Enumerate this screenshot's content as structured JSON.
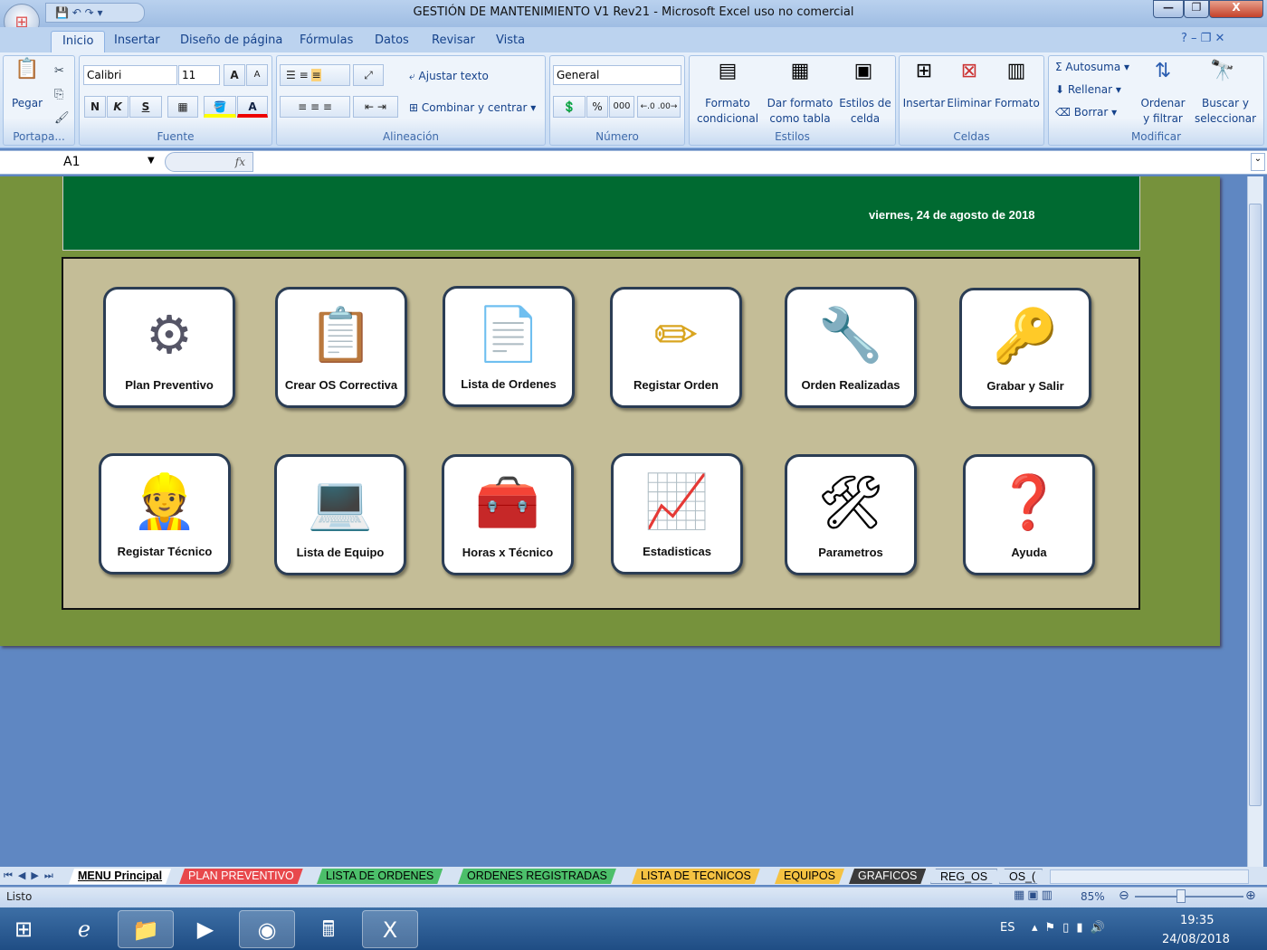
{
  "window": {
    "title": "GESTIÓN DE MANTENIMIENTO V1 Rev21  -  Microsoft Excel uso no comercial",
    "minimize": "—",
    "restore": "❐",
    "close": "X"
  },
  "ribbon_tabs": [
    "Inicio",
    "Insertar",
    "Diseño de página",
    "Fórmulas",
    "Datos",
    "Revisar",
    "Vista"
  ],
  "clipboard": {
    "paste": "Pegar",
    "label": "Portapa..."
  },
  "font": {
    "name": "Calibri",
    "size": "11",
    "grow": "A",
    "shrink": "A",
    "bold": "N",
    "italic": "K",
    "underline": "S",
    "label": "Fuente"
  },
  "alignment": {
    "wrap": "Ajustar texto",
    "merge": "Combinar y centrar",
    "label": "Alineación"
  },
  "number": {
    "format": "General",
    "percent": "%",
    "thousands": "000",
    "label": "Número"
  },
  "styles": {
    "conditional": "Formato condicional",
    "table": "Dar formato como tabla",
    "cell": "Estilos de celda",
    "label": "Estilos"
  },
  "cells": {
    "insert": "Insertar",
    "delete": "Eliminar",
    "format": "Formato",
    "label": "Celdas"
  },
  "editing": {
    "autosum": "Autosuma",
    "fill": "Rellenar",
    "clear": "Borrar",
    "sort": "Ordenar y filtrar",
    "find": "Buscar y seleccionar",
    "label": "Modificar"
  },
  "formula_bar": {
    "name_box": "A1",
    "fx": "fx",
    "value": ""
  },
  "sheet": {
    "date": "viernes, 24 de agosto de 2018"
  },
  "menu_buttons": [
    {
      "label": "Plan Preventivo",
      "icon": "⚙"
    },
    {
      "label": "Crear OS Correctiva",
      "icon": "📋"
    },
    {
      "label": "Lista de Ordenes",
      "icon": "📄"
    },
    {
      "label": "Registar Orden",
      "icon": "✏"
    },
    {
      "label": "Orden Realizadas",
      "icon": "🔧"
    },
    {
      "label": "Grabar y Salir",
      "icon": "🔑"
    },
    {
      "label": "Registar Técnico",
      "icon": "👷"
    },
    {
      "label": "Lista de Equipo",
      "icon": "💻"
    },
    {
      "label": "Horas x Técnico",
      "icon": "🧰"
    },
    {
      "label": "Estadisticas",
      "icon": "📈"
    },
    {
      "label": "Parametros",
      "icon": "🛠"
    },
    {
      "label": "Ayuda",
      "icon": "❓"
    }
  ],
  "sheet_tabs": [
    {
      "label": "MENU Principal",
      "color": "#ffffff"
    },
    {
      "label": "PLAN PREVENTIVO",
      "color": "#e8484c"
    },
    {
      "label": "LISTA DE ORDENES",
      "color": "#4cbf6a"
    },
    {
      "label": "ORDENES REGISTRADAS",
      "color": "#4cbf6a"
    },
    {
      "label": "LISTA DE TECNICOS",
      "color": "#f5c242"
    },
    {
      "label": "EQUIPOS",
      "color": "#f5c242"
    },
    {
      "label": "GRAFICOS",
      "color": "#3a3a3a"
    },
    {
      "label": "REG_OS",
      "color": "#d6e3f3"
    },
    {
      "label": "OS_(",
      "color": "#d6e3f3"
    }
  ],
  "status": {
    "text": "Listo",
    "zoom": "85%",
    "zoom_value": 85
  },
  "taskbar": {
    "lang": "ES",
    "time": "19:35",
    "date": "24/08/2018"
  }
}
